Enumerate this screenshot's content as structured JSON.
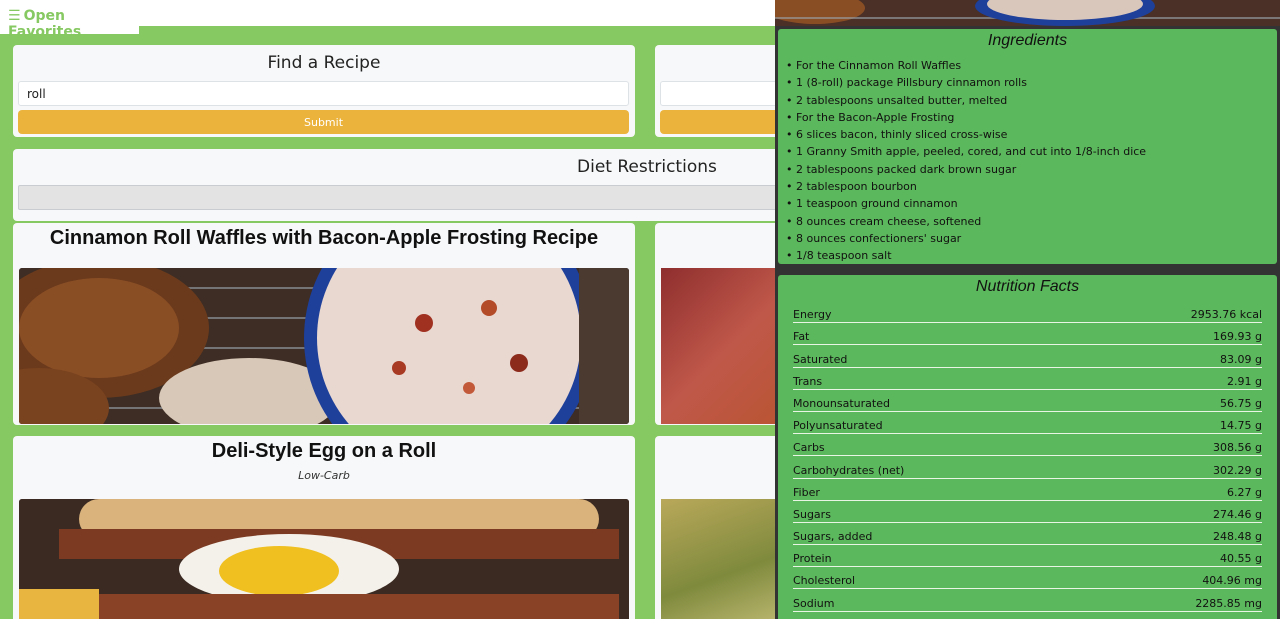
{
  "header": {
    "menu_icon": "hamburger-icon",
    "favorites_label": "Open Favorites"
  },
  "search": {
    "title": "Find a Recipe",
    "value": "roll",
    "submit_label": "Submit"
  },
  "diet": {
    "title": "Diet Restrictions"
  },
  "recipes": [
    {
      "title": "Cinnamon Roll Waffles with Bacon-Apple Frosting Recipe",
      "tag": ""
    },
    {
      "title": "Deli-Style Egg on a Roll",
      "tag": "Low-Carb"
    }
  ],
  "ingredients": {
    "title": "Ingredients",
    "items": [
      "For the Cinnamon Roll Waffles",
      "1 (8-roll) package Pillsbury cinnamon rolls",
      "2 tablespoons unsalted butter, melted",
      "For the Bacon-Apple Frosting",
      "6 slices bacon, thinly sliced cross-wise",
      "1 Granny Smith apple, peeled, cored, and cut into 1/8-inch dice",
      "2 tablespoons packed dark brown sugar",
      "2 tablespoon bourbon",
      "1 teaspoon ground cinnamon",
      "8 ounces cream cheese, softened",
      "8 ounces confectioners' sugar",
      "1/8 teaspoon salt"
    ]
  },
  "nutrition": {
    "title": "Nutrition Facts",
    "rows": [
      {
        "label": "Energy",
        "value": "2953.76 kcal"
      },
      {
        "label": "Fat",
        "value": "169.93 g"
      },
      {
        "label": "Saturated",
        "value": "83.09 g"
      },
      {
        "label": "Trans",
        "value": "2.91 g"
      },
      {
        "label": "Monounsaturated",
        "value": "56.75 g"
      },
      {
        "label": "Polyunsaturated",
        "value": "14.75 g"
      },
      {
        "label": "Carbs",
        "value": "308.56 g"
      },
      {
        "label": "Carbohydrates (net)",
        "value": "302.29 g"
      },
      {
        "label": "Fiber",
        "value": "6.27 g"
      },
      {
        "label": "Sugars",
        "value": "274.46 g"
      },
      {
        "label": "Sugars, added",
        "value": "248.48 g"
      },
      {
        "label": "Protein",
        "value": "40.55 g"
      },
      {
        "label": "Cholesterol",
        "value": "404.96 mg"
      },
      {
        "label": "Sodium",
        "value": "2285.85 mg"
      }
    ]
  },
  "colors": {
    "brand_green": "#86c861",
    "button_orange": "#ebb33c",
    "panel_green": "#5cb85c"
  }
}
